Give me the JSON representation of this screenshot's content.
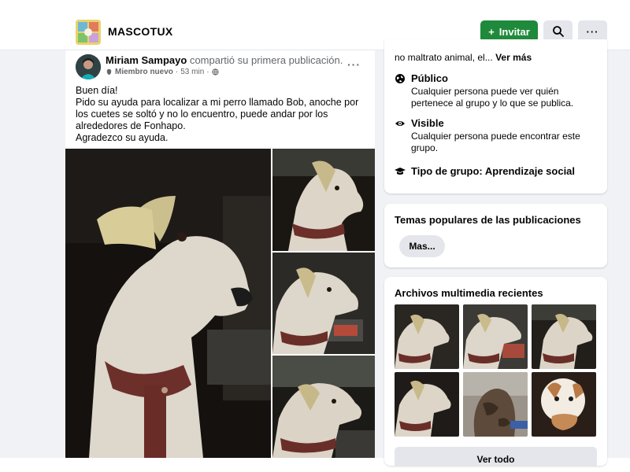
{
  "header": {
    "group_name": "MASCOTUX",
    "invite_label": "Invitar"
  },
  "post": {
    "author": "Miriam Sampayo",
    "action": "compartió su primera publicación.",
    "badge": "Miembro nuevo",
    "time": "53 min",
    "text_lines": [
      "Buen día!",
      "Pido su ayuda para localizar a mi perro llamado Bob, anoche por",
      "los cuetes se soltó y no lo encuentro, puede andar por los",
      "alrededores de Fonhapo.",
      "Agradezco su ayuda."
    ]
  },
  "sidebar": {
    "about": {
      "truncated_text": "no maltrato animal, el...",
      "see_more_label": "Ver más",
      "items": [
        {
          "icon": "globe-icon",
          "title": "Público",
          "description": "Cualquier persona puede ver quién pertenece al grupo y lo que se publica."
        },
        {
          "icon": "eye-icon",
          "title": "Visible",
          "description": "Cualquier persona puede encontrar este grupo."
        },
        {
          "icon": "graduation-cap-icon",
          "title": "Tipo de grupo: Aprendizaje social",
          "description": ""
        }
      ]
    },
    "topics": {
      "title": "Temas populares de las publicaciones",
      "chip_label": "Mas..."
    },
    "media": {
      "title": "Archivos multimedia recientes",
      "see_all_label": "Ver todo"
    }
  },
  "colors": {
    "accent_green": "#1f8a3b",
    "feed_background": "#f0f2f5",
    "secondary_text": "#65676b",
    "button_gray": "#e4e6eb"
  }
}
